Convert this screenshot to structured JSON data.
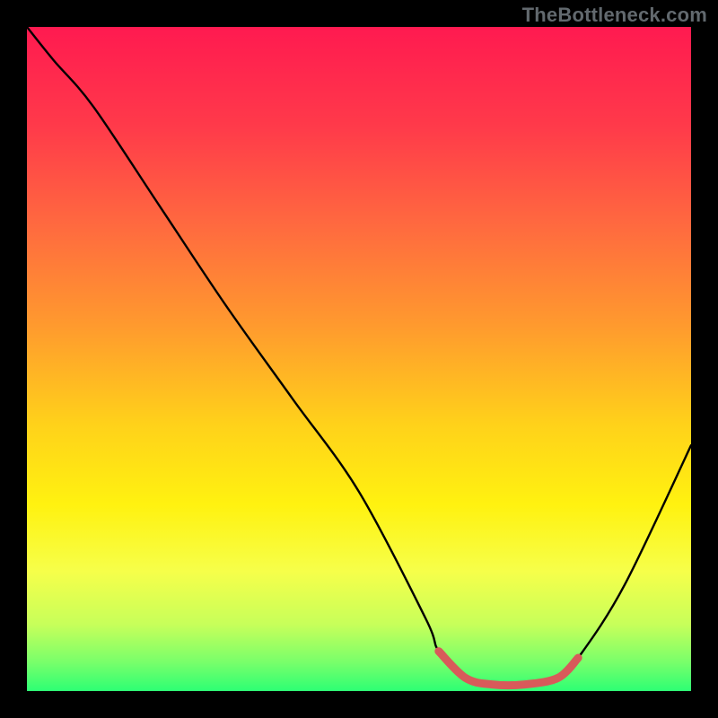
{
  "watermark": "TheBottleneck.com",
  "colors": {
    "background": "#000000",
    "gradient_stops": [
      {
        "offset": 0.0,
        "color": "#ff1a50"
      },
      {
        "offset": 0.15,
        "color": "#ff3a4a"
      },
      {
        "offset": 0.3,
        "color": "#ff6a3f"
      },
      {
        "offset": 0.45,
        "color": "#ff9a2e"
      },
      {
        "offset": 0.6,
        "color": "#ffd21a"
      },
      {
        "offset": 0.72,
        "color": "#fff210"
      },
      {
        "offset": 0.82,
        "color": "#f6ff4a"
      },
      {
        "offset": 0.9,
        "color": "#c7ff5a"
      },
      {
        "offset": 0.955,
        "color": "#7bff6a"
      },
      {
        "offset": 1.0,
        "color": "#2dff74"
      }
    ],
    "curve": "#000000",
    "flat_segment": "#d85a5a"
  },
  "chart_data": {
    "type": "line",
    "title": "",
    "xlabel": "",
    "ylabel": "",
    "xlim": [
      0,
      100
    ],
    "ylim": [
      0,
      100
    ],
    "grid": false,
    "series": [
      {
        "name": "bottleneck-curve",
        "x": [
          0,
          4,
          10,
          20,
          30,
          40,
          50,
          60,
          62,
          66,
          70,
          75,
          80,
          83,
          90,
          100
        ],
        "y": [
          100,
          95,
          88,
          73,
          58,
          44,
          30,
          11,
          6,
          2,
          1,
          1,
          2,
          5,
          16,
          37
        ]
      }
    ],
    "annotations": [
      {
        "name": "optimal-flat-band",
        "x": [
          62,
          66,
          70,
          75,
          80,
          83
        ],
        "y": [
          6,
          2,
          1,
          1,
          2,
          5
        ],
        "color": "#d85a5a"
      }
    ]
  }
}
